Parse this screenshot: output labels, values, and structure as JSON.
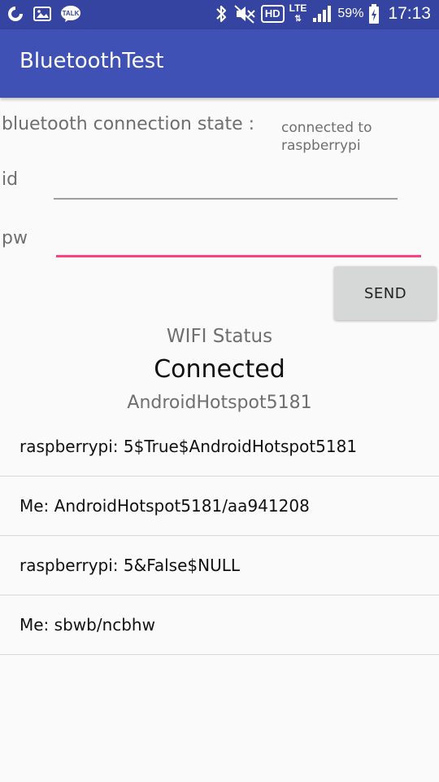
{
  "status_bar": {
    "left_icons": [
      "swirl-app-icon",
      "image-notification-icon",
      "kakaotalk-icon"
    ],
    "talk_text": "TALK",
    "hd_text": "HD",
    "lte_text": "LTE",
    "battery_text": "59%",
    "time": "17:13"
  },
  "app_bar": {
    "title": "BluetoothTest"
  },
  "connection": {
    "label": "bluetooth connection state :",
    "value": "connected to raspberrypi"
  },
  "form": {
    "id_label": "id",
    "id_value": "",
    "pw_label": "pw",
    "pw_value": "",
    "send_label": "SEND"
  },
  "wifi": {
    "title": "WIFI Status",
    "state": "Connected",
    "ssid": "AndroidHotspot5181"
  },
  "messages": [
    "raspberrypi: 5$True$AndroidHotspot5181",
    "Me: AndroidHotspot5181/aa941208",
    "raspberrypi: 5&False$NULL",
    "Me: sbwb/ncbhw"
  ],
  "colors": {
    "status_bar": "#3444a0",
    "app_bar": "#3f51b5",
    "accent": "#ff4081",
    "background": "#fafafa"
  }
}
